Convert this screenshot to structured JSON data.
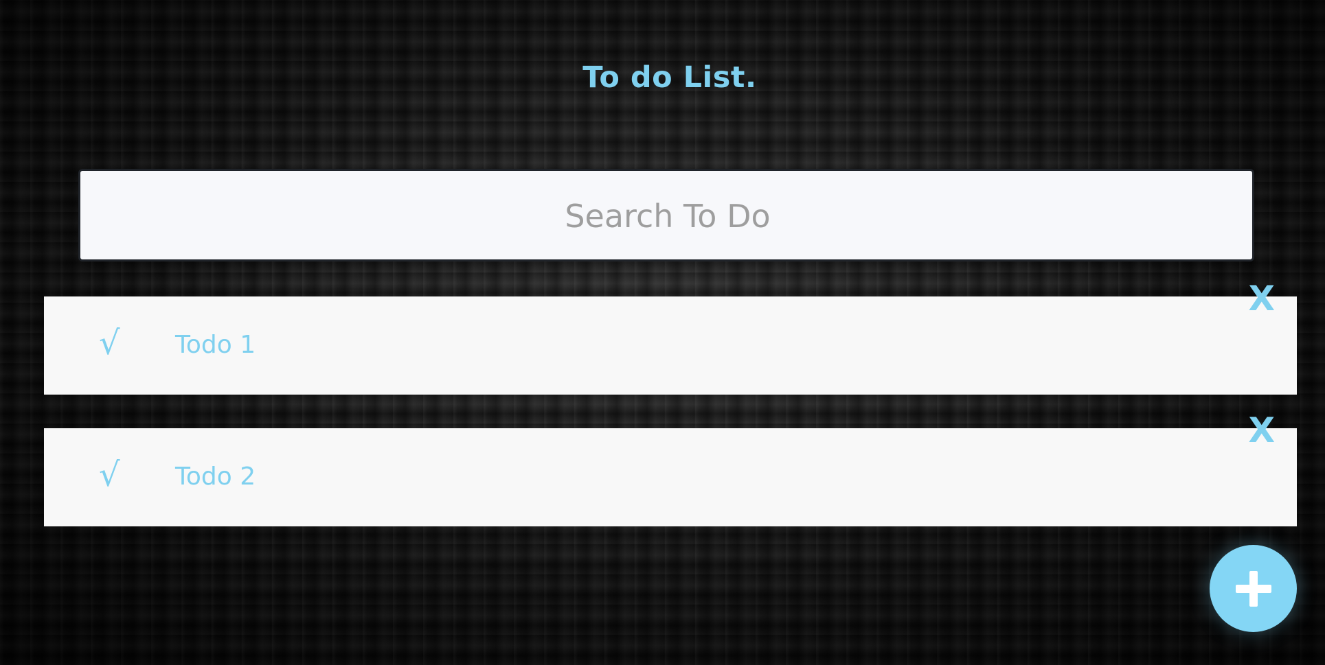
{
  "header": {
    "title": "To do List."
  },
  "search": {
    "placeholder": "Search To Do",
    "value": ""
  },
  "todos": [
    {
      "check_label": "√",
      "text": "Todo 1",
      "delete_label": "X"
    },
    {
      "check_label": "√",
      "text": "Todo 2",
      "delete_label": "X"
    }
  ],
  "actions": {
    "add_icon": "plus-icon"
  },
  "colors": {
    "accent": "#7fd0ef",
    "item_background": "#f8f8f8",
    "search_background": "#f7f8fb",
    "add_button": "#84d6f5"
  }
}
